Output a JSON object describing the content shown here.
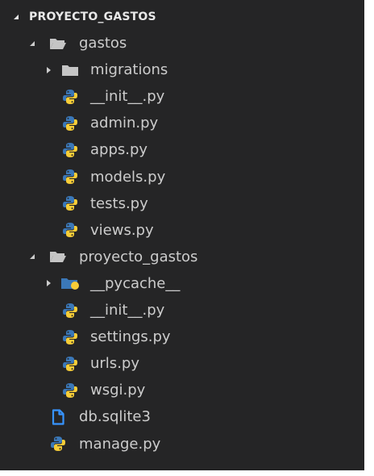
{
  "explorer": {
    "root": {
      "label": "PROYECTO_GASTOS",
      "expanded": true
    },
    "items": [
      {
        "label": "gastos",
        "kind": "folder",
        "depth": 1,
        "expanded": true,
        "icon": "folder-open-icon"
      },
      {
        "label": "migrations",
        "kind": "folder",
        "depth": 2,
        "expanded": false,
        "icon": "folder-icon"
      },
      {
        "label": "__init__.py",
        "kind": "file",
        "depth": 2,
        "icon": "python-icon"
      },
      {
        "label": "admin.py",
        "kind": "file",
        "depth": 2,
        "icon": "python-icon"
      },
      {
        "label": "apps.py",
        "kind": "file",
        "depth": 2,
        "icon": "python-icon"
      },
      {
        "label": "models.py",
        "kind": "file",
        "depth": 2,
        "icon": "python-icon"
      },
      {
        "label": "tests.py",
        "kind": "file",
        "depth": 2,
        "icon": "python-icon"
      },
      {
        "label": "views.py",
        "kind": "file",
        "depth": 2,
        "icon": "python-icon"
      },
      {
        "label": "proyecto_gastos",
        "kind": "folder",
        "depth": 1,
        "expanded": true,
        "icon": "folder-open-icon"
      },
      {
        "label": "__pycache__",
        "kind": "folder",
        "depth": 2,
        "expanded": false,
        "icon": "python-folder-icon"
      },
      {
        "label": "__init__.py",
        "kind": "file",
        "depth": 2,
        "icon": "python-icon"
      },
      {
        "label": "settings.py",
        "kind": "file",
        "depth": 2,
        "icon": "python-icon"
      },
      {
        "label": "urls.py",
        "kind": "file",
        "depth": 2,
        "icon": "python-icon"
      },
      {
        "label": "wsgi.py",
        "kind": "file",
        "depth": 2,
        "icon": "python-icon"
      },
      {
        "label": "db.sqlite3",
        "kind": "file",
        "depth": 1,
        "icon": "file-icon"
      },
      {
        "label": "manage.py",
        "kind": "file",
        "depth": 1,
        "icon": "python-icon"
      }
    ]
  },
  "colors": {
    "background": "#252526",
    "text": "#cccccc",
    "root_text": "#e8e8e8",
    "folder": "#c5c5c5",
    "python_blue": "#3b78b8",
    "python_yellow": "#f7cd38",
    "file_blue": "#3794ff"
  }
}
